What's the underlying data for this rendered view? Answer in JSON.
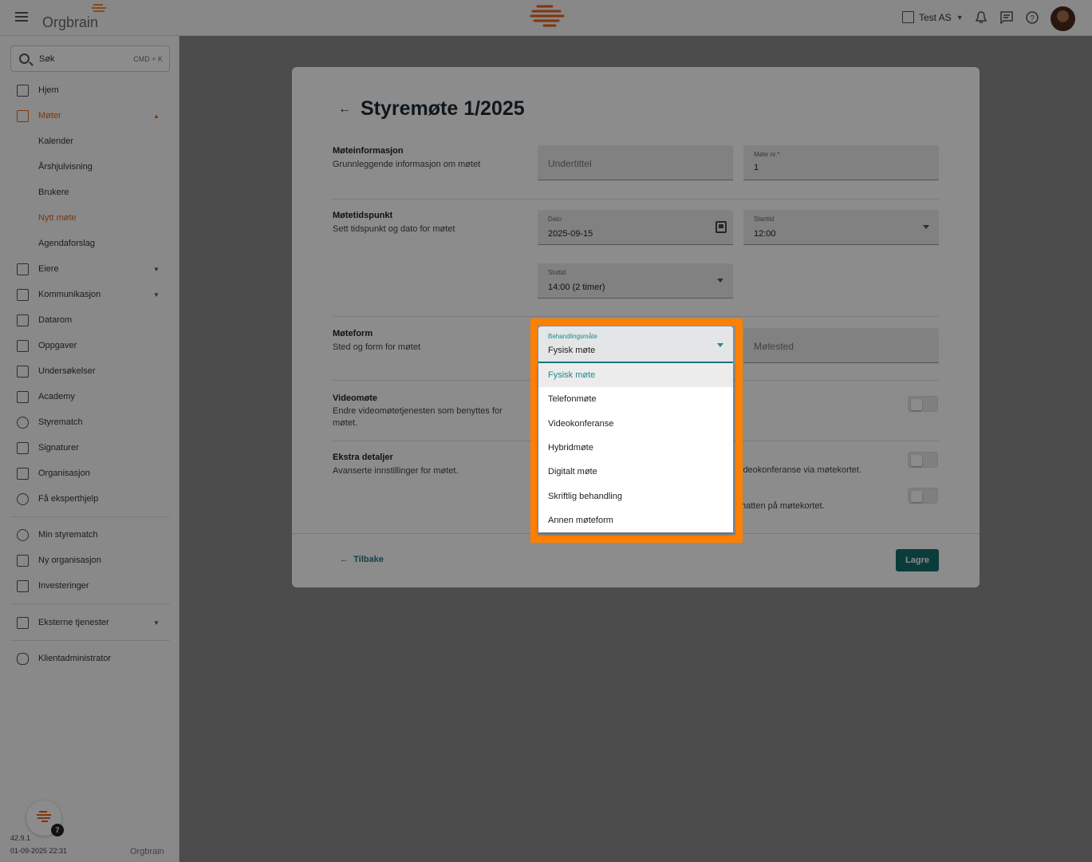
{
  "topbar": {
    "brand": "Orgbrain",
    "org_name": "Test AS"
  },
  "sidebar": {
    "search_label": "Søk",
    "search_shortcut": "CMD + K",
    "items": [
      {
        "label": "Hjem"
      },
      {
        "label": "Møter"
      },
      {
        "label": "Kalender"
      },
      {
        "label": "Årshjulvisning"
      },
      {
        "label": "Brukere"
      },
      {
        "label": "Nytt møte"
      },
      {
        "label": "Agendaforslag"
      },
      {
        "label": "Eiere"
      },
      {
        "label": "Kommunikasjon"
      },
      {
        "label": "Datarom"
      },
      {
        "label": "Oppgaver"
      },
      {
        "label": "Undersøkelser"
      },
      {
        "label": "Academy"
      },
      {
        "label": "Styrematch"
      },
      {
        "label": "Signaturer"
      },
      {
        "label": "Organisasjon"
      },
      {
        "label": "Få eksperthjelp"
      },
      {
        "label": "Min styrematch"
      },
      {
        "label": "Ny organisasjon"
      },
      {
        "label": "Investeringer"
      },
      {
        "label": "Eksterne tjenester"
      },
      {
        "label": "Klientadministrator"
      }
    ],
    "version": "42.9.1",
    "build_date": "01-09-2025 22:31",
    "help_badge": "7",
    "footer_brand": "Orgbrain"
  },
  "card": {
    "title": "Styremøte 1/2025",
    "sections": {
      "info": {
        "title": "Møteinformasjon",
        "subtitle": "Grunnleggende informasjon om møtet"
      },
      "time": {
        "title": "Møtetidspunkt",
        "subtitle": "Sett tidspunkt og dato for møtet"
      },
      "form": {
        "title": "Møteform",
        "subtitle": "Sted og form for møtet"
      },
      "video": {
        "title": "Videomøte",
        "subtitle": "Endre videomøtetjenesten som benyttes for møtet."
      },
      "extra": {
        "title": "Ekstra detaljer",
        "subtitle": "Avanserte innstillinger for møtet."
      }
    },
    "fields": {
      "subtitle_placeholder": "Undertittel",
      "meeting_no_label": "Møte nr.*",
      "meeting_no_value": "1",
      "date_label": "Dato",
      "date_value": "2025-09-15",
      "start_label": "Starttid",
      "start_value": "12:00",
      "end_label": "Sluttid",
      "end_value": "14:00 (2 timer)",
      "location_placeholder": "Møtested"
    },
    "clipped_texts": {
      "video_conf": "ideokonferanse via møtekortet.",
      "chat": "hatten på møtekortet."
    },
    "back_label": "Tilbake",
    "save_label": "Lagre"
  },
  "dropdown": {
    "label": "Behandlingsmåte",
    "value": "Fysisk møte",
    "options": [
      "Fysisk møte",
      "Telefonmøte",
      "Videokonferanse",
      "Hybridmøte",
      "Digitalt møte",
      "Skriftlig behandling",
      "Annen møteform"
    ],
    "selected_index": 0
  },
  "colors": {
    "accent_orange": "#e2651a",
    "highlight_orange": "#ff8000",
    "teal": "#136e6c"
  }
}
